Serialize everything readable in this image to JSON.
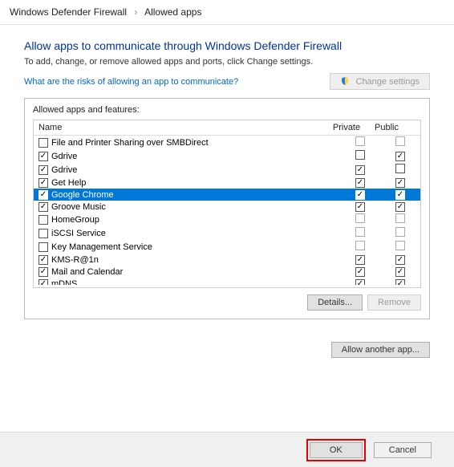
{
  "breadcrumb": {
    "parent": "Windows Defender Firewall",
    "current": "Allowed apps"
  },
  "header": "Allow apps to communicate through Windows Defender Firewall",
  "subtext": "To add, change, or remove allowed apps and ports, click Change settings.",
  "risk_link": "What are the risks of allowing an app to communicate?",
  "change_settings_label": "Change settings",
  "group_label": "Allowed apps and features:",
  "columns": {
    "name": "Name",
    "private": "Private",
    "public": "Public"
  },
  "details_label": "Details...",
  "remove_label": "Remove",
  "allow_another_label": "Allow another app...",
  "ok_label": "OK",
  "cancel_label": "Cancel",
  "apps": [
    {
      "name": "File and Printer Sharing over SMBDirect",
      "enabled": false,
      "private": false,
      "public": false
    },
    {
      "name": "Gdrive",
      "enabled": true,
      "private": false,
      "public": true
    },
    {
      "name": "Gdrive",
      "enabled": true,
      "private": true,
      "public": false
    },
    {
      "name": "Get Help",
      "enabled": true,
      "private": true,
      "public": true
    },
    {
      "name": "Google Chrome",
      "enabled": true,
      "private": true,
      "public": true,
      "selected": true
    },
    {
      "name": "Groove Music",
      "enabled": true,
      "private": true,
      "public": true
    },
    {
      "name": "HomeGroup",
      "enabled": false,
      "private": false,
      "public": false
    },
    {
      "name": "iSCSI Service",
      "enabled": false,
      "private": false,
      "public": false
    },
    {
      "name": "Key Management Service",
      "enabled": false,
      "private": false,
      "public": false
    },
    {
      "name": "KMS-R@1n",
      "enabled": true,
      "private": true,
      "public": true
    },
    {
      "name": "Mail and Calendar",
      "enabled": true,
      "private": true,
      "public": true
    },
    {
      "name": "mDNS",
      "enabled": true,
      "private": true,
      "public": true
    }
  ]
}
